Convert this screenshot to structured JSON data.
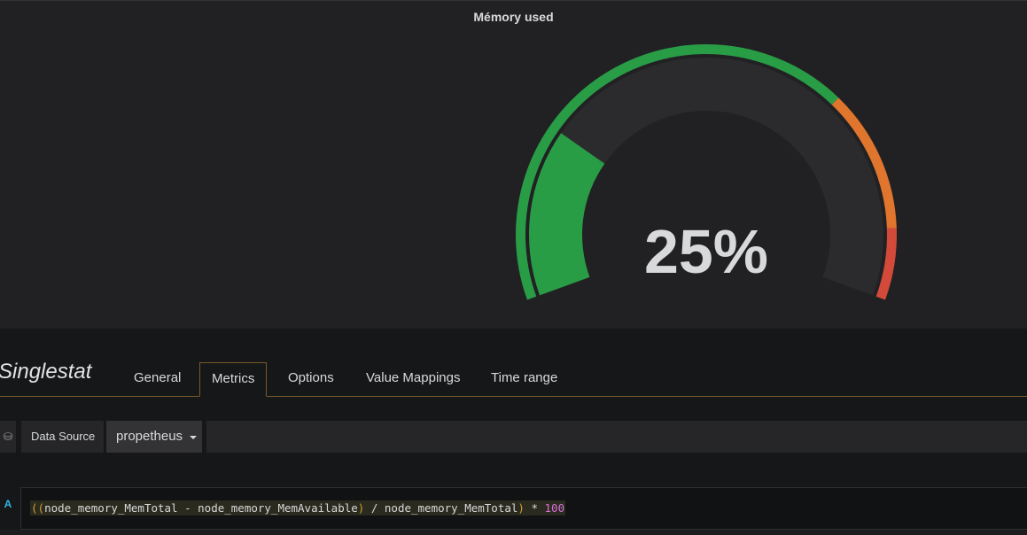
{
  "panel": {
    "title": "Mémory used",
    "gauge": {
      "value_text": "25%",
      "value_percent": 25,
      "min": 0,
      "max": 100,
      "thresholds": [
        {
          "from": 0,
          "to": 70,
          "color": "#299c46"
        },
        {
          "from": 70,
          "to": 90,
          "color": "#e0752d"
        },
        {
          "from": 90,
          "to": 100,
          "color": "#d44a3a"
        }
      ],
      "value_color": "#299c46",
      "track_color": "#2b2b2d",
      "text_color": "#d8d9da"
    }
  },
  "editor": {
    "title": "Singlestat",
    "tabs": [
      {
        "label": "General",
        "active": false
      },
      {
        "label": "Metrics",
        "active": true
      },
      {
        "label": "Options",
        "active": false
      },
      {
        "label": "Value Mappings",
        "active": false
      },
      {
        "label": "Time range",
        "active": false
      }
    ],
    "datasource": {
      "icon": "database-icon",
      "label": "Data Source",
      "selected": "propetheus"
    },
    "query": {
      "ref_id": "A",
      "open_parens": "((",
      "expr_part1": "node_memory_MemTotal - node_memory_MemAvailable",
      "close_paren": ")",
      "expr_part2": " / node_memory_MemTotal",
      "close_paren2": ")",
      "operator": " * ",
      "number": "100"
    }
  }
}
